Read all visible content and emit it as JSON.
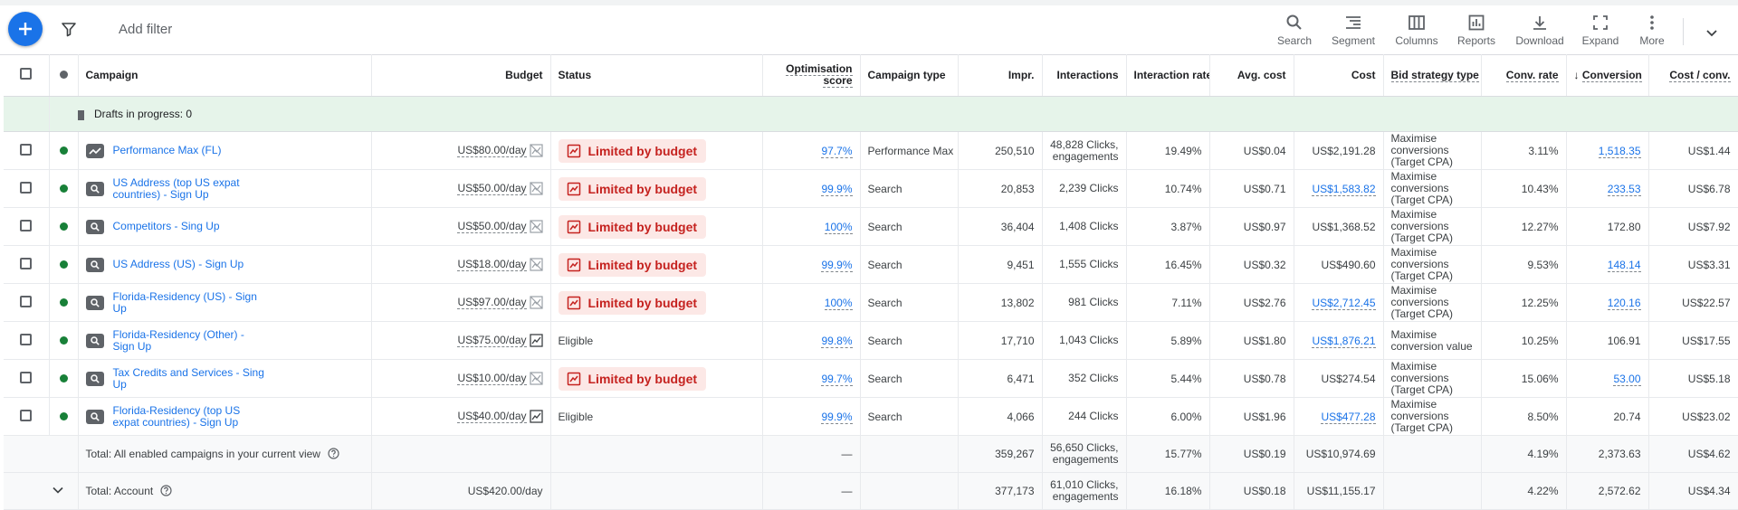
{
  "toolbar": {
    "add_filter": "Add filter",
    "tools": [
      {
        "label": "Search",
        "icon": "search-icon"
      },
      {
        "label": "Segment",
        "icon": "segment-icon"
      },
      {
        "label": "Columns",
        "icon": "columns-icon"
      },
      {
        "label": "Reports",
        "icon": "reports-icon"
      },
      {
        "label": "Download",
        "icon": "download-icon"
      },
      {
        "label": "Expand",
        "icon": "expand-icon"
      },
      {
        "label": "More",
        "icon": "more-vert-icon"
      }
    ]
  },
  "colors": {
    "accent": "#1a73e8",
    "limited_bg": "#fce8e6",
    "limited_text": "#c5221f",
    "enabled": "#188038",
    "drafts_bg": "#e6f4ea"
  },
  "columns": [
    "Campaign",
    "Budget",
    "Status",
    "Optimisation score",
    "Campaign type",
    "Impr.",
    "Interactions",
    "Interaction rate",
    "Avg. cost",
    "Cost",
    "Bid strategy type",
    "Conv. rate",
    "Conversion",
    "Cost / conv."
  ],
  "drafts": {
    "label": "Drafts in progress: 0"
  },
  "rows": [
    {
      "campaign": "Performance Max (FL)",
      "budget": "US$80.00/day",
      "status": "Limited by budget",
      "score": "97.7%",
      "type": "Performance Max",
      "impr": "250,510",
      "interactions": "48,828 Clicks, engagements",
      "rate": "19.49%",
      "avg_cost": "US$0.04",
      "cost": "US$2,191.28",
      "bid": "Maximise conversions (Target CPA)",
      "conv_rate": "3.11%",
      "conv": "1,518.35",
      "cost_conv": "US$1.44"
    },
    {
      "campaign": "US Address (top US expat countries) - Sign Up",
      "budget": "US$50.00/day",
      "status": "Limited by budget",
      "score": "99.9%",
      "type": "Search",
      "impr": "20,853",
      "interactions": "2,239 Clicks",
      "rate": "10.74%",
      "avg_cost": "US$0.71",
      "cost": "US$1,583.82",
      "bid": "Maximise conversions (Target CPA)",
      "conv_rate": "10.43%",
      "conv": "233.53",
      "cost_conv": "US$6.78"
    },
    {
      "campaign": "Competitors - Sing Up",
      "budget": "US$50.00/day",
      "status": "Limited by budget",
      "score": "100%",
      "type": "Search",
      "impr": "36,404",
      "interactions": "1,408 Clicks",
      "rate": "3.87%",
      "avg_cost": "US$0.97",
      "cost": "US$1,368.52",
      "bid": "Maximise conversions (Target CPA)",
      "conv_rate": "12.27%",
      "conv": "172.80",
      "cost_conv": "US$7.92"
    },
    {
      "campaign": "US Address (US) - Sign Up",
      "budget": "US$18.00/day",
      "status": "Limited by budget",
      "score": "99.9%",
      "type": "Search",
      "impr": "9,451",
      "interactions": "1,555 Clicks",
      "rate": "16.45%",
      "avg_cost": "US$0.32",
      "cost": "US$490.60",
      "bid": "Maximise conversions (Target CPA)",
      "conv_rate": "9.53%",
      "conv": "148.14",
      "cost_conv": "US$3.31"
    },
    {
      "campaign": "Florida-Residency (US) - Sign Up",
      "budget": "US$97.00/day",
      "status": "Limited by budget",
      "score": "100%",
      "type": "Search",
      "impr": "13,802",
      "interactions": "981 Clicks",
      "rate": "7.11%",
      "avg_cost": "US$2.76",
      "cost": "US$2,712.45",
      "bid": "Maximise conversions (Target CPA)",
      "conv_rate": "12.25%",
      "conv": "120.16",
      "cost_conv": "US$22.57"
    },
    {
      "campaign": "Florida-Residency (Other) - Sign Up",
      "budget": "US$75.00/day",
      "status": "Eligible",
      "score": "99.8%",
      "type": "Search",
      "impr": "17,710",
      "interactions": "1,043 Clicks",
      "rate": "5.89%",
      "avg_cost": "US$1.80",
      "cost": "US$1,876.21",
      "bid": "Maximise conversion value",
      "conv_rate": "10.25%",
      "conv": "106.91",
      "cost_conv": "US$17.55"
    },
    {
      "campaign": "Tax Credits and Services - Sing Up",
      "budget": "US$10.00/day",
      "status": "Limited by budget",
      "score": "99.7%",
      "type": "Search",
      "impr": "6,471",
      "interactions": "352 Clicks",
      "rate": "5.44%",
      "avg_cost": "US$0.78",
      "cost": "US$274.54",
      "bid": "Maximise conversions (Target CPA)",
      "conv_rate": "15.06%",
      "conv": "53.00",
      "cost_conv": "US$5.18"
    },
    {
      "campaign": "Florida-Residency (top US expat countries) - Sign Up",
      "budget": "US$40.00/day",
      "status": "Eligible",
      "score": "99.9%",
      "type": "Search",
      "impr": "4,066",
      "interactions": "244 Clicks",
      "rate": "6.00%",
      "avg_cost": "US$1.96",
      "cost": "US$477.28",
      "bid": "Maximise conversions (Target CPA)",
      "conv_rate": "8.50%",
      "conv": "20.74",
      "cost_conv": "US$23.02"
    }
  ],
  "totals": [
    {
      "label": "Total: All enabled campaigns in your current view",
      "budget": "",
      "score": "—",
      "impr": "359,267",
      "interactions": "56,650 Clicks, engagements",
      "rate": "15.77%",
      "avg_cost": "US$0.19",
      "cost": "US$10,974.69",
      "conv_rate": "4.19%",
      "conv": "2,373.63",
      "cost_conv": "US$4.62"
    },
    {
      "label": "Total: Account",
      "budget": "US$420.00/day",
      "score": "—",
      "impr": "377,173",
      "interactions": "61,010 Clicks, engagements",
      "rate": "16.18%",
      "avg_cost": "US$0.18",
      "cost": "US$11,155.17",
      "conv_rate": "4.22%",
      "conv": "2,572.62",
      "cost_conv": "US$4.34"
    }
  ]
}
